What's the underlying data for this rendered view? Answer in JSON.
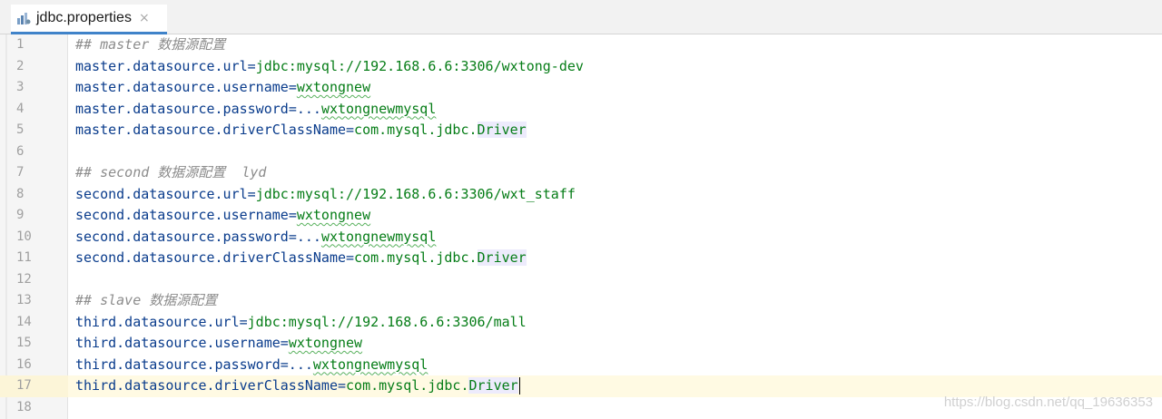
{
  "tab": {
    "label": "jdbc.properties",
    "icon": "properties-file-icon",
    "close": "×"
  },
  "lines": [
    {
      "n": "1",
      "comment": "## master 数据源配置"
    },
    {
      "n": "2",
      "key": "master.datasource.url",
      "sep": "=",
      "value": "jdbc:mysql://192.168.6.6:3306/wxtong-dev"
    },
    {
      "n": "3",
      "key": "master.datasource.username",
      "sep": "=",
      "value": "wxtongnew"
    },
    {
      "n": "4",
      "key": "master.datasource.password",
      "sep": "=...",
      "value": "wxtongnewmysql"
    },
    {
      "n": "5",
      "key": "master.datasource.driverClassName",
      "sep": "=",
      "value": "com.mysql.jdbc.",
      "value_hl": "Driver"
    },
    {
      "n": "6"
    },
    {
      "n": "7",
      "comment": "## second 数据源配置  lyd"
    },
    {
      "n": "8",
      "key": "second.datasource.url",
      "sep": "=",
      "value": "jdbc:mysql://192.168.6.6:3306/wxt_staff"
    },
    {
      "n": "9",
      "key": "second.datasource.username",
      "sep": "=",
      "value": "wxtongnew"
    },
    {
      "n": "10",
      "key": "second.datasource.password",
      "sep": "=...",
      "value": "wxtongnewmysql"
    },
    {
      "n": "11",
      "key": "second.datasource.driverClassName",
      "sep": "=",
      "value": "com.mysql.jdbc.",
      "value_hl": "Driver"
    },
    {
      "n": "12"
    },
    {
      "n": "13",
      "comment": "## slave 数据源配置"
    },
    {
      "n": "14",
      "key": "third.datasource.url",
      "sep": "=",
      "value": "jdbc:mysql://192.168.6.6:3306/mall"
    },
    {
      "n": "15",
      "key": "third.datasource.username",
      "sep": "=",
      "value": "wxtongnew"
    },
    {
      "n": "16",
      "key": "third.datasource.password",
      "sep": "=...",
      "value": "wxtongnewmysql"
    },
    {
      "n": "17",
      "key": "third.datasource.driverClassName",
      "sep": "=",
      "value": "com.mysql.jdbc.",
      "value_hl": "Driver",
      "current": true
    },
    {
      "n": "18"
    }
  ],
  "watermark": "https://blog.csdn.net/qq_19636353",
  "colors": {
    "key": "#0a3c8c",
    "value": "#067d17",
    "comment": "#8c8c8c",
    "current_line": "#fffae3",
    "tab_accent": "#4083c9"
  }
}
